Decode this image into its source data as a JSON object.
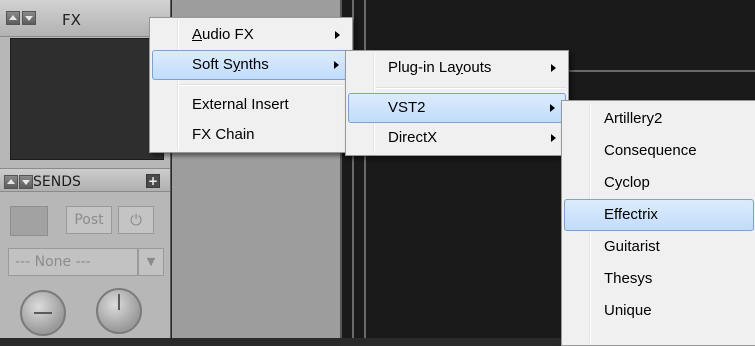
{
  "fx_panel": {
    "title": "FX",
    "sends_title": "SENDS",
    "post_label": "Post",
    "none_label": "--- None ---"
  },
  "menu_main": {
    "items": [
      {
        "label": "Audio FX",
        "has_submenu": true,
        "highlighted": false
      },
      {
        "label": "Soft Synths",
        "has_submenu": true,
        "highlighted": true
      },
      {
        "label": "External Insert",
        "has_submenu": false,
        "highlighted": false
      },
      {
        "label": "FX Chain",
        "has_submenu": false,
        "highlighted": false
      }
    ]
  },
  "menu_soft_synths": {
    "items": [
      {
        "label": "Plug-in Layouts",
        "has_submenu": true,
        "highlighted": false
      },
      {
        "label": "VST2",
        "has_submenu": true,
        "highlighted": true
      },
      {
        "label": "DirectX",
        "has_submenu": true,
        "highlighted": false
      }
    ]
  },
  "menu_vst2": {
    "items": [
      {
        "label": "Artillery2",
        "highlighted": false
      },
      {
        "label": "Consequence",
        "highlighted": false
      },
      {
        "label": "Cyclop",
        "highlighted": false
      },
      {
        "label": "Effectrix",
        "highlighted": true
      },
      {
        "label": "Guitarist",
        "highlighted": false
      },
      {
        "label": "Thesys",
        "highlighted": false
      },
      {
        "label": "Unique",
        "highlighted": false
      }
    ]
  },
  "colors": {
    "menu_background": "#f0f0f0",
    "highlight": "#c1dcfc",
    "highlight_border": "#7da2ce",
    "panel_gray": "#b7b7b7",
    "dark_area": "#1a1a1a"
  }
}
